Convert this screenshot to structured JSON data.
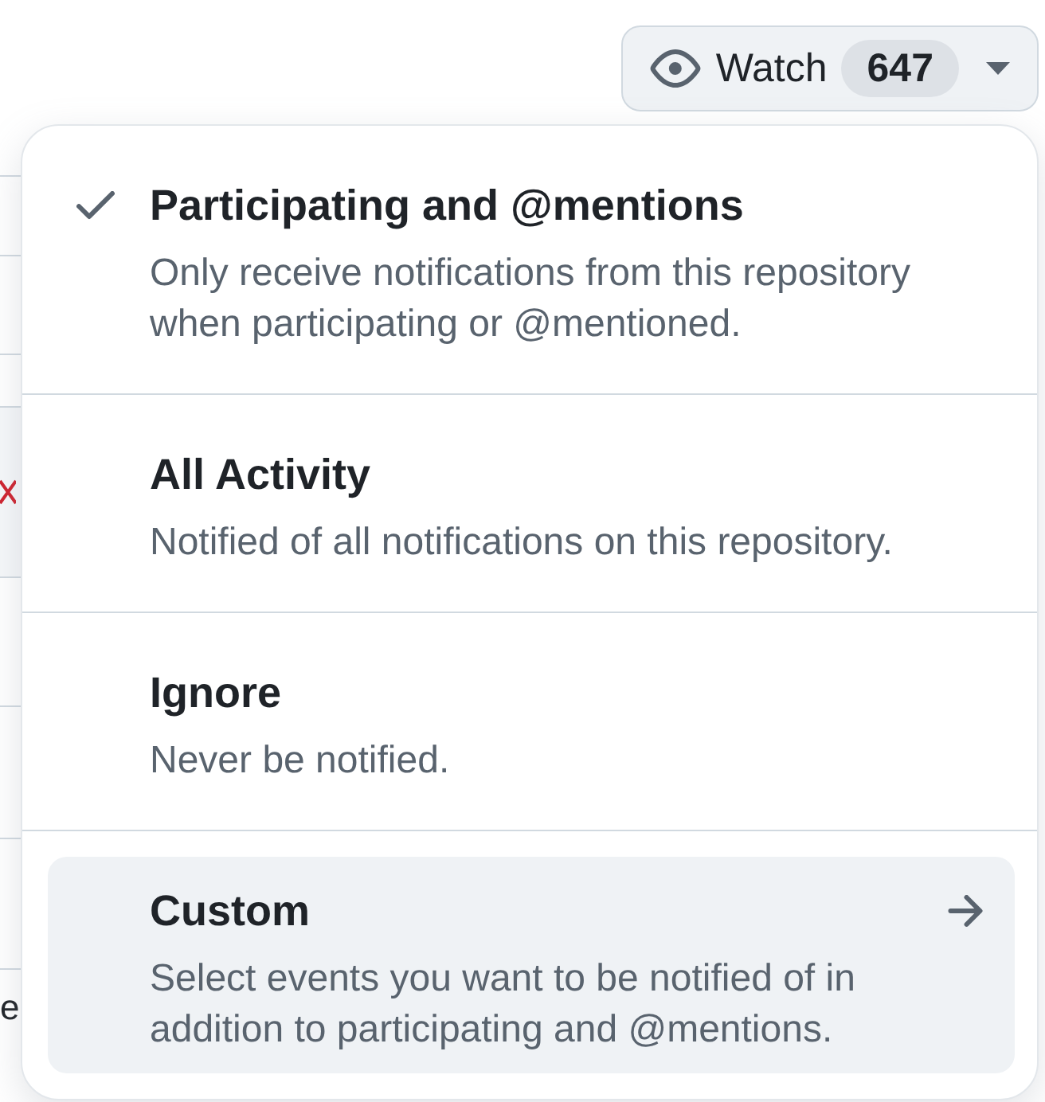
{
  "watch_button": {
    "label": "Watch",
    "count": "647"
  },
  "background_list": {
    "cut_text": "e"
  },
  "menu": {
    "items": [
      {
        "kind": "option",
        "title": "Participating and @mentions",
        "description": "Only receive notifications from this repository when participating or @mentioned.",
        "selected": true,
        "highlighted": false
      },
      {
        "kind": "option",
        "title": "All Activity",
        "description": "Notified of all notifications on this repository.",
        "selected": false,
        "highlighted": false
      },
      {
        "kind": "option",
        "title": "Ignore",
        "description": "Never be notified.",
        "selected": false,
        "highlighted": false
      },
      {
        "kind": "submenu",
        "title": "Custom",
        "description": "Select events you want to be notified of in addition to participating and @mentions.",
        "selected": false,
        "highlighted": true
      }
    ]
  }
}
